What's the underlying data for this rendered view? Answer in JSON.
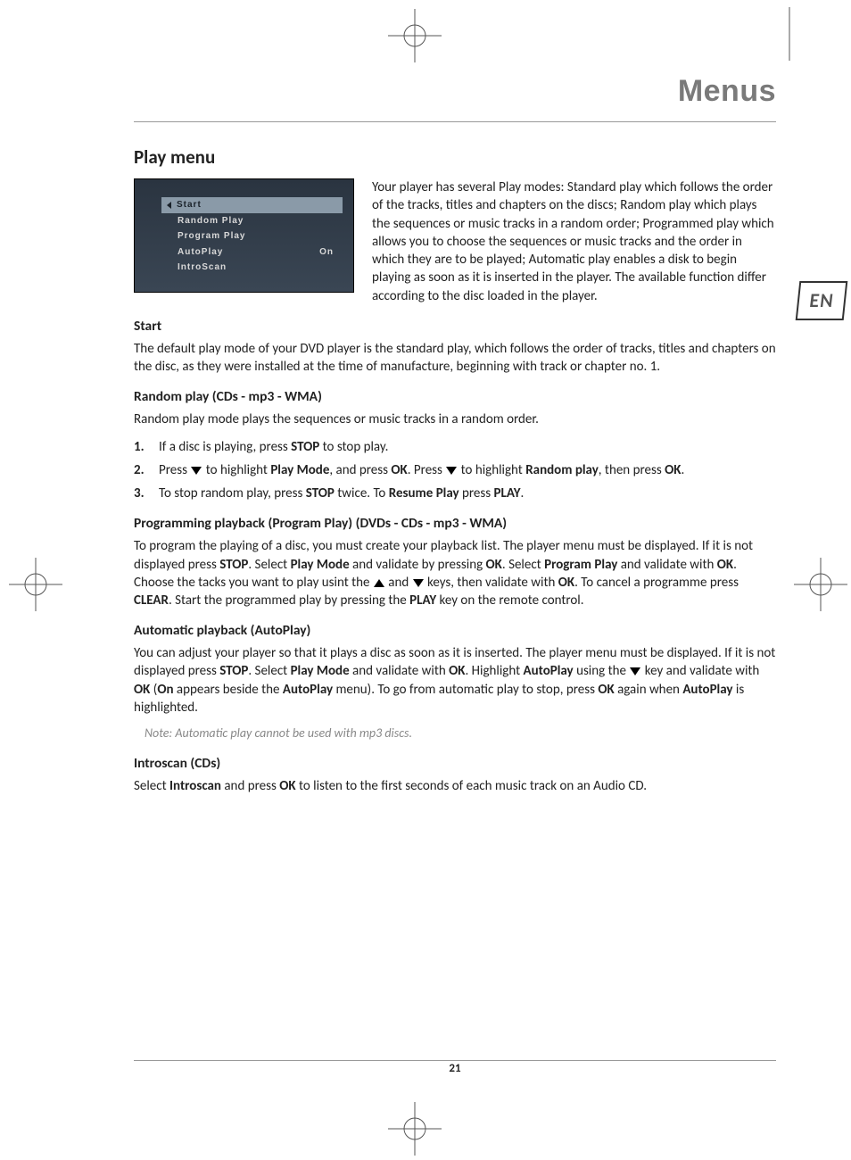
{
  "chapterTitle": "Menus",
  "sectionTitle": "Play menu",
  "langTab": "EN",
  "menuScreenshot": {
    "items": [
      {
        "label": "Start",
        "value": "",
        "selected": true
      },
      {
        "label": "Random Play",
        "value": "",
        "selected": false
      },
      {
        "label": "Program Play",
        "value": "",
        "selected": false
      },
      {
        "label": "AutoPlay",
        "value": "On",
        "selected": false
      },
      {
        "label": "IntroScan",
        "value": "",
        "selected": false
      }
    ]
  },
  "introText": "Your player has several Play modes: Standard play which follows the order of the tracks, titles and chapters on the discs; Random play which plays the sequences or music tracks in a random order; Programmed play which allows you to choose the sequences or music tracks and the order in which they are to be played; Automatic play enables a disk to begin playing as soon as it is inserted in the player. The available function differ according to the disc loaded in the player.",
  "start": {
    "heading": "Start",
    "text": "The default play mode of your DVD player is the standard play, which follows the order of tracks, titles and chapters on the disc, as they were installed at the time of manufacture, beginning with track or chapter no. 1."
  },
  "random": {
    "heading": "Random play (CDs - mp3 - WMA)",
    "text": "Random play mode plays the sequences or music tracks in a random order.",
    "steps": {
      "s1a": "If a disc is playing, press ",
      "s1b": " to stop play.",
      "s2a": "Press ",
      "s2b": " to highlight ",
      "s2c": ", and press ",
      "s2d": ". Press ",
      "s2e": " to highlight ",
      "s2f": ", then press ",
      "s2g": ".",
      "s3a": "To stop random play, press ",
      "s3b": " twice. To ",
      "s3c": " press ",
      "s3d": "."
    },
    "bold": {
      "stop": "STOP",
      "playMode": "Play Mode",
      "ok": "OK",
      "randomPlay": "Random play",
      "resumePlay": "Resume Play",
      "play": "PLAY"
    }
  },
  "program": {
    "heading": "Programming playback (Program Play) (DVDs - CDs - mp3 - WMA)",
    "t1": "To program the playing of a disc, you must create your playback list. The player menu must be displayed. If it is not displayed press ",
    "t2": ". Select ",
    "t3": " and validate by pressing ",
    "t4": ". Select ",
    "t5": " and validate with ",
    "t6": ". Choose the tacks you want to play usint the ",
    "t7": " and ",
    "t8": " keys, then validate with ",
    "t9": ". To cancel a programme press ",
    "t10": ". Start the programmed play by pressing the ",
    "t11": " key on the remote control.",
    "bold": {
      "stop": "STOP",
      "playMode": "Play Mode",
      "ok": "OK",
      "programPlay": "Program Play",
      "clear": "CLEAR",
      "play": "PLAY"
    }
  },
  "autoplay": {
    "heading": "Automatic playback (AutoPlay)",
    "t1": "You can adjust your player so that it plays a disc as soon as it is inserted. The player menu must be displayed. If it is not displayed press ",
    "t2": ". Select ",
    "t3": " and validate with ",
    "t4": ". Highlight ",
    "t5": " using the ",
    "t6": " key and validate with ",
    "t7": " (",
    "t8": " appears beside the ",
    "t9": " menu). To go from automatic play to stop, press ",
    "t10": " again when ",
    "t11": " is highlighted.",
    "bold": {
      "stop": "STOP",
      "playMode": "Play Mode",
      "ok": "OK",
      "autoPlay": "AutoPlay",
      "on": "On"
    },
    "note": "Note: Automatic play cannot be used with mp3 discs."
  },
  "introscan": {
    "heading": "Introscan (CDs)",
    "t1": "Select ",
    "t2": " and press ",
    "t3": " to listen to the first seconds of each music track on an Audio CD.",
    "bold": {
      "introscan": "Introscan",
      "ok": "OK"
    }
  },
  "pageNumber": "21"
}
